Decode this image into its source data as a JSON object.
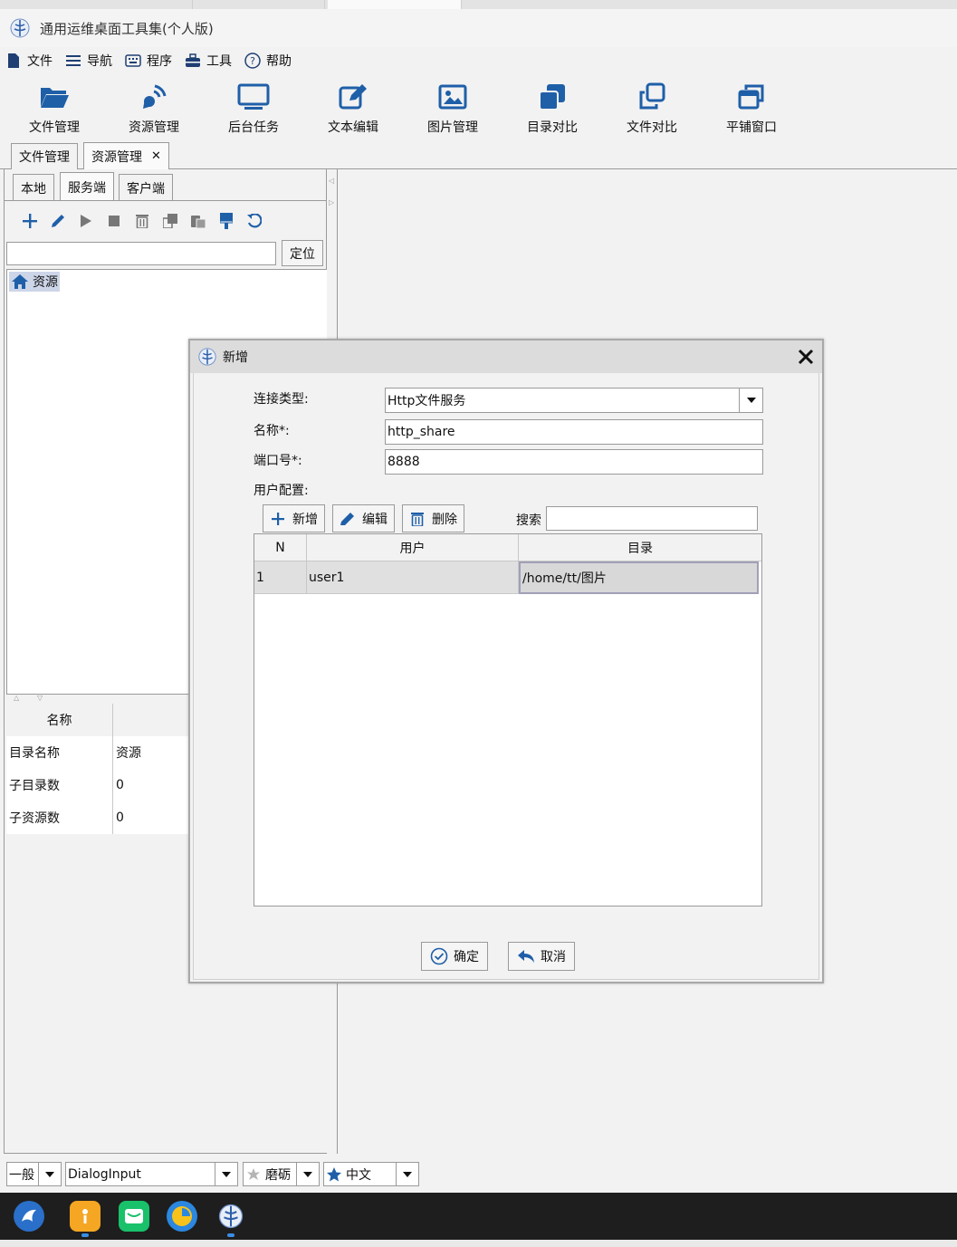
{
  "window": {
    "title": "通用运维桌面工具集(个人版)"
  },
  "menu": [
    {
      "label": "文件",
      "icon": "file-icon"
    },
    {
      "label": "导航",
      "icon": "bars-icon"
    },
    {
      "label": "程序",
      "icon": "keyboard-icon"
    },
    {
      "label": "工具",
      "icon": "toolbox-icon"
    },
    {
      "label": "帮助",
      "icon": "help-icon"
    }
  ],
  "toolbar": [
    {
      "label": "文件管理",
      "icon": "folder-open-icon"
    },
    {
      "label": "资源管理",
      "icon": "satellite-icon"
    },
    {
      "label": "后台任务",
      "icon": "monitor-icon"
    },
    {
      "label": "文本编辑",
      "icon": "edit-icon"
    },
    {
      "label": "图片管理",
      "icon": "image-icon"
    },
    {
      "label": "目录对比",
      "icon": "copy-solid-icon"
    },
    {
      "label": "文件对比",
      "icon": "copy-outline-icon"
    },
    {
      "label": "平铺窗口",
      "icon": "window-restore-icon"
    }
  ],
  "doc_tabs": [
    {
      "label": "文件管理",
      "active": false
    },
    {
      "label": "资源管理",
      "active": true,
      "close": "✕"
    }
  ],
  "left_panel": {
    "sub_tabs": [
      {
        "label": "本地",
        "active": false
      },
      {
        "label": "服务端",
        "active": true
      },
      {
        "label": "客户端",
        "active": false
      }
    ],
    "tools": [
      "add-icon",
      "edit-icon",
      "play-icon",
      "stop-icon",
      "trash-icon",
      "copy-icon",
      "paste-icon",
      "brush-icon",
      "refresh-icon"
    ],
    "locate_input": "",
    "locate_button": "定位",
    "tree_root": "资源",
    "props": {
      "header": "名称",
      "rows": [
        {
          "name": "目录名称",
          "value": "资源"
        },
        {
          "name": "子目录数",
          "value": "0"
        },
        {
          "name": "子资源数",
          "value": "0"
        }
      ]
    }
  },
  "dialog": {
    "title": "新增",
    "close": "✕",
    "fields": {
      "conn_type_label": "连接类型:",
      "conn_type_value": "Http文件服务",
      "name_label": "名称*:",
      "name_value": "http_share",
      "port_label": "端口号*:",
      "port_value": "8888",
      "user_config_label": "用户配置:"
    },
    "user_buttons": {
      "add": "新增",
      "edit": "编辑",
      "delete": "删除"
    },
    "search_label": "搜索",
    "search_value": "",
    "table": {
      "columns": [
        "N",
        "用户",
        "目录"
      ],
      "rows": [
        {
          "n": "1",
          "user": "user1",
          "dir": "/home/tt/图片"
        }
      ]
    },
    "ok": "确定",
    "cancel": "取消"
  },
  "statusbar": {
    "level": "一般",
    "font": "DialogInput",
    "theme": "磨砺",
    "lang": "中文"
  },
  "colors": {
    "accent": "#1f5fa8",
    "taskbar": "#1e1e1e"
  }
}
